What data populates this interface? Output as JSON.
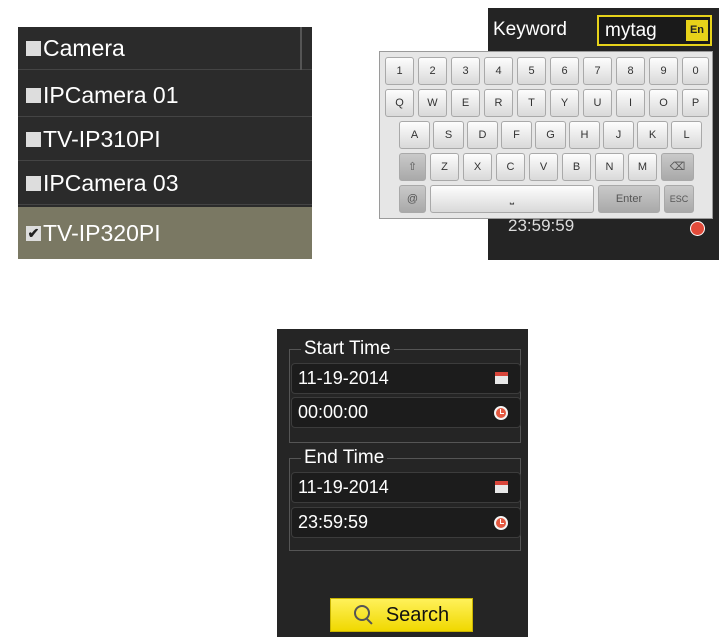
{
  "camera_list": {
    "items": [
      {
        "label": "Camera",
        "checked": false,
        "selected": false
      },
      {
        "label": "IPCamera 01",
        "checked": false,
        "selected": false
      },
      {
        "label": "TV-IP310PI",
        "checked": false,
        "selected": false
      },
      {
        "label": "IPCamera 03",
        "checked": false,
        "selected": false
      },
      {
        "label": "TV-IP320PI",
        "checked": true,
        "selected": true
      }
    ]
  },
  "keyword": {
    "label": "Keyword",
    "value": "mytag",
    "lang": "En"
  },
  "keyboard": {
    "row1": [
      "1",
      "2",
      "3",
      "4",
      "5",
      "6",
      "7",
      "8",
      "9",
      "0"
    ],
    "row2": [
      "Q",
      "W",
      "E",
      "R",
      "T",
      "Y",
      "U",
      "I",
      "O",
      "P"
    ],
    "row3": [
      "A",
      "S",
      "D",
      "F",
      "G",
      "H",
      "J",
      "K",
      "L"
    ],
    "row4": [
      "Z",
      "X",
      "C",
      "V",
      "B",
      "N",
      "M"
    ],
    "enter_label": "Enter",
    "esc_label": "ESC",
    "background_time": "23:59:59"
  },
  "start_time": {
    "title": "Start Time",
    "date": "11-19-2014",
    "time": "00:00:00"
  },
  "end_time": {
    "title": "End Time",
    "date": "11-19-2014",
    "time": "23:59:59"
  },
  "search_label": "Search",
  "colors": {
    "accent_yellow": "#f0d800",
    "selected_row": "#7a7863",
    "panel_bg": "#252525"
  }
}
